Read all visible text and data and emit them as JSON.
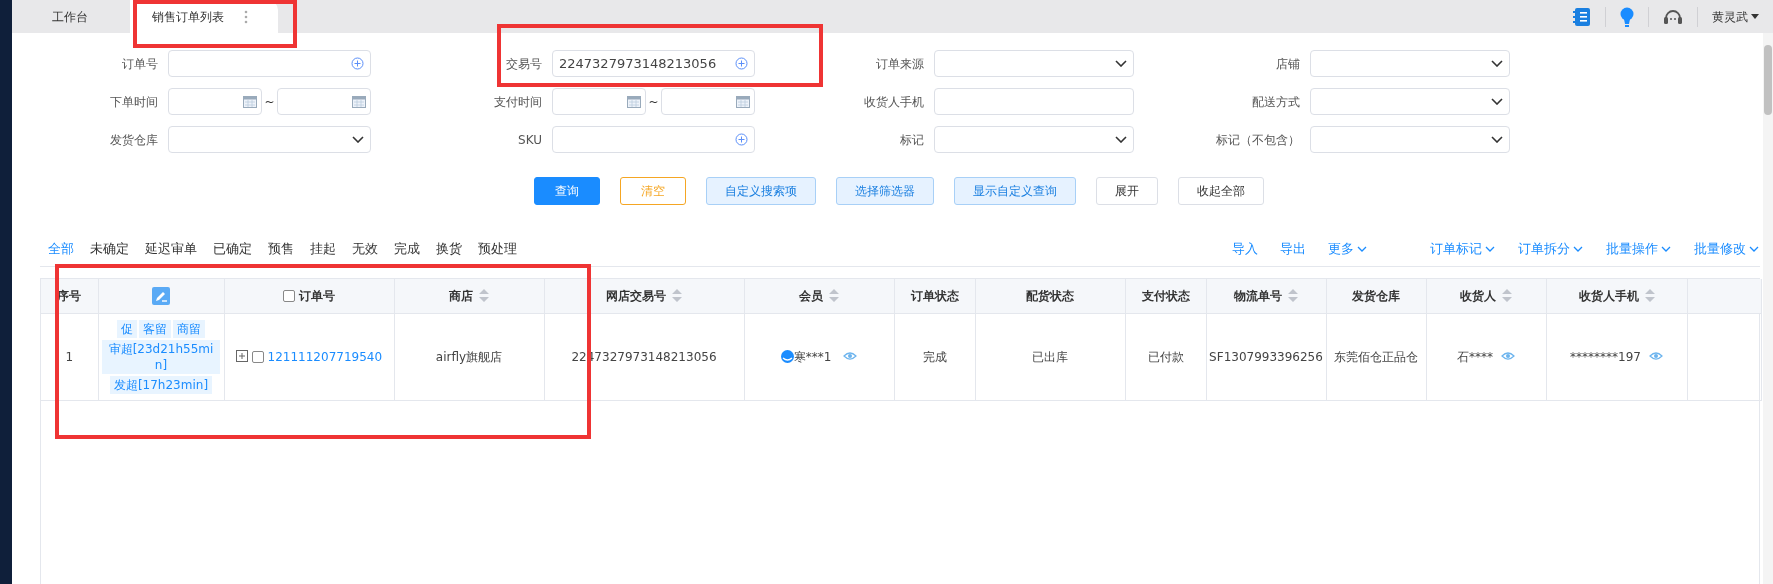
{
  "tabs": [
    {
      "label": "工作台",
      "selected": false
    },
    {
      "label": "销售订单列表",
      "selected": true
    }
  ],
  "user": {
    "name": "黄灵武"
  },
  "filters": [
    [
      {
        "label": "订单号",
        "kind": "text-add"
      },
      {
        "label": "交易号",
        "kind": "text-add",
        "value": "2247327973148213056"
      },
      {
        "label": "订单来源",
        "kind": "select"
      },
      {
        "label": "店铺",
        "kind": "select"
      }
    ],
    [
      {
        "label": "下单时间",
        "kind": "date-range",
        "separator": "~"
      },
      {
        "label": "支付时间",
        "kind": "date-range",
        "separator": "~"
      },
      {
        "label": "收货人手机",
        "kind": "text"
      },
      {
        "label": "配送方式",
        "kind": "select"
      }
    ],
    [
      {
        "label": "发货仓库",
        "kind": "select"
      },
      {
        "label": "SKU",
        "kind": "text-add"
      },
      {
        "label": "标记",
        "kind": "select"
      },
      {
        "label": "标记（不包含）",
        "kind": "select"
      }
    ]
  ],
  "buttons": [
    {
      "label": "查询",
      "kind": "primary"
    },
    {
      "label": "清空",
      "kind": "warning"
    },
    {
      "label": "自定义搜索项",
      "kind": "light"
    },
    {
      "label": "选择筛选器",
      "kind": "light"
    },
    {
      "label": "显示自定义查询",
      "kind": "light"
    },
    {
      "label": "展开",
      "kind": "default"
    },
    {
      "label": "收起全部",
      "kind": "default"
    }
  ],
  "status_tabs": [
    {
      "label": "全部",
      "selected": true
    },
    {
      "label": "未确定",
      "selected": false
    },
    {
      "label": "延迟审单",
      "selected": false
    },
    {
      "label": "已确定",
      "selected": false
    },
    {
      "label": "预售",
      "selected": false
    },
    {
      "label": "挂起",
      "selected": false
    },
    {
      "label": "无效",
      "selected": false
    },
    {
      "label": "完成",
      "selected": false
    },
    {
      "label": "换货",
      "selected": false
    },
    {
      "label": "预处理",
      "selected": false
    }
  ],
  "actions": [
    {
      "label": "导入",
      "dropdown": false
    },
    {
      "label": "导出",
      "dropdown": false
    },
    {
      "label": "更多",
      "dropdown": true
    }
  ],
  "batch_actions": [
    {
      "label": "订单标记",
      "dropdown": true
    },
    {
      "label": "订单拆分",
      "dropdown": true
    },
    {
      "label": "批量操作",
      "dropdown": true
    },
    {
      "label": "批量修改",
      "dropdown": true
    }
  ],
  "table": {
    "columns": [
      {
        "kind": "text",
        "label": "序号",
        "sortable": false
      },
      {
        "kind": "icon"
      },
      {
        "kind": "checkbox",
        "label": "订单号",
        "checked": false
      },
      {
        "kind": "text",
        "label": "商店",
        "sortable": true
      },
      {
        "kind": "text",
        "label": "网店交易号",
        "sortable": true
      },
      {
        "kind": "text",
        "label": "会员",
        "sortable": true
      },
      {
        "kind": "text",
        "label": "订单状态",
        "sortable": false
      },
      {
        "kind": "text",
        "label": "配货状态",
        "sortable": false
      },
      {
        "kind": "text",
        "label": "支付状态",
        "sortable": false
      },
      {
        "kind": "text",
        "label": "物流单号",
        "sortable": true
      },
      {
        "kind": "text",
        "label": "发货仓库",
        "sortable": false
      },
      {
        "kind": "text",
        "label": "收货人",
        "sortable": true
      },
      {
        "kind": "text",
        "label": "收货人手机",
        "sortable": true
      },
      {
        "kind": "empty"
      }
    ],
    "rows": [
      {
        "index": "1",
        "tags": [
          "促",
          "客留",
          "商留"
        ],
        "timers": [
          "审超[23d21h55min]",
          "发超[17h23min]"
        ],
        "expanded": false,
        "checked": false,
        "order_no": "121111207719540",
        "shop": "airfly旗舰店",
        "trade_no": "2247327973148213056",
        "member": "寒***1",
        "order_status": "完成",
        "allocation_status": "已出库",
        "payment_status": "已付款",
        "tracking_no": "SF1307993396256",
        "warehouse": "东莞佰仓正品仓",
        "receiver": "石****",
        "receiver_phone": "********197"
      }
    ]
  },
  "annotations": [
    {
      "kind": "highlight-box"
    },
    {
      "kind": "highlight-box"
    },
    {
      "kind": "highlight-box"
    }
  ]
}
